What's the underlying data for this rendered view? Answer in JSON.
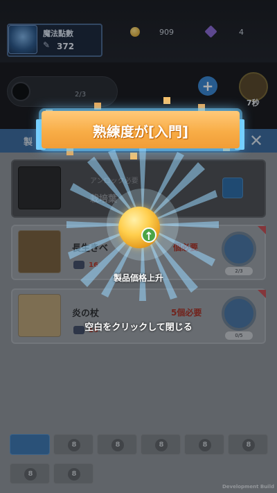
{
  "player": {
    "name": "魔法點數",
    "points": "372"
  },
  "currency": {
    "coins": "909",
    "gems": "4"
  },
  "queue": {
    "count": "2/3"
  },
  "timer": {
    "label": "7秒"
  },
  "panel": {
    "tab_label": "製"
  },
  "items": [
    {
      "status_label": "アンロック必要",
      "name": "栽培葉"
    },
    {
      "name": "長生きベ",
      "requirement": "個必要",
      "material_count": "16",
      "progress": "2/3"
    },
    {
      "name": "炎の杖",
      "requirement": "5個必要",
      "material_count": "16",
      "progress": "0/5"
    }
  ],
  "overlay": {
    "banner_title": "熟練度が[入門]",
    "effect_label": "製品価格上升",
    "close_hint": "空白をクリックして閉じる"
  },
  "tabs": [
    {
      "icon": "tools-icon",
      "active": true
    },
    {
      "icon": "lock-icon",
      "label": "8"
    },
    {
      "icon": "lock-icon",
      "label": "8"
    },
    {
      "icon": "lock-icon",
      "label": "8"
    },
    {
      "icon": "lock-icon",
      "label": "8"
    },
    {
      "icon": "lock-icon",
      "label": "8"
    },
    {
      "icon": "lock-icon",
      "label": "8"
    },
    {
      "icon": "lock-icon",
      "label": "8"
    }
  ],
  "footer": {
    "build_label": "Development Build"
  },
  "colors": {
    "banner": "#f8ad47",
    "accent_blue": "#78d1ff",
    "coin": "#ffce4c",
    "arrow_green": "#4ca446"
  }
}
